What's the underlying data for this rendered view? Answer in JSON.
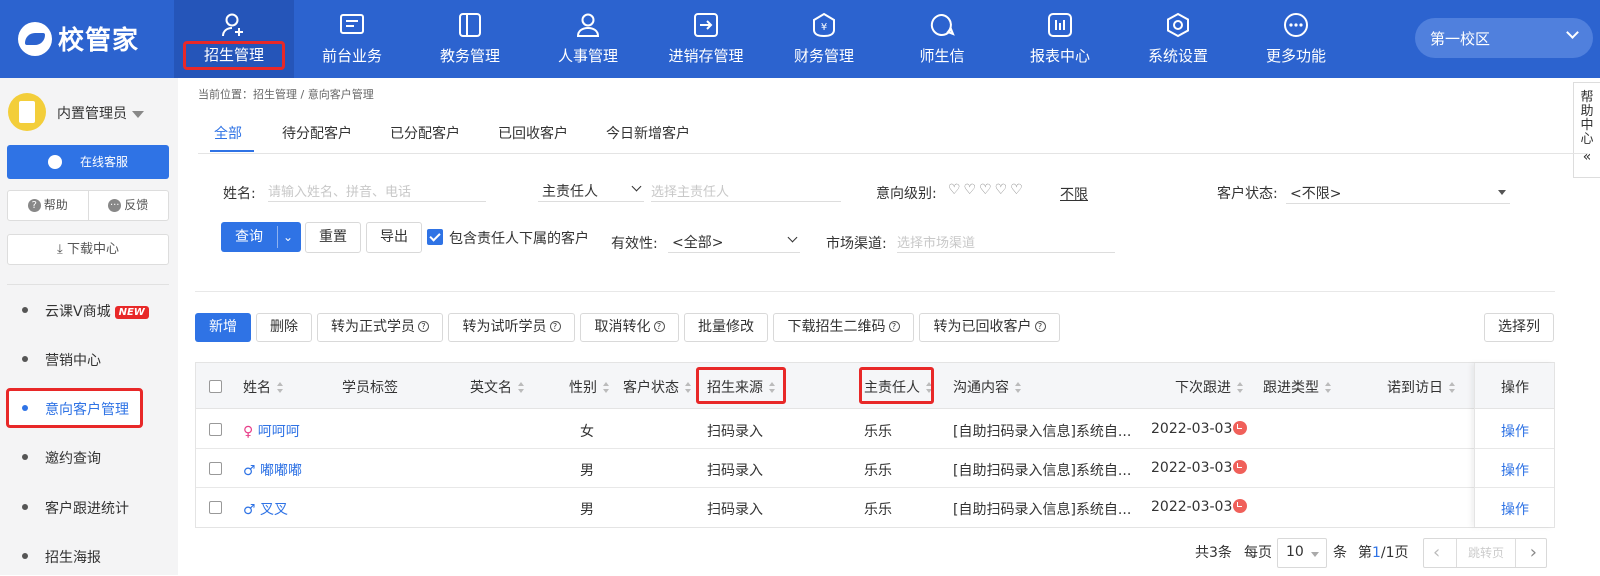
{
  "app": {
    "logo_text": "校管家",
    "campus": "第一校区"
  },
  "nav": [
    {
      "label": "招生管理",
      "icon": "user-add-icon"
    },
    {
      "label": "前台业务",
      "icon": "monitor-icon"
    },
    {
      "label": "教务管理",
      "icon": "book-icon"
    },
    {
      "label": "人事管理",
      "icon": "person-icon"
    },
    {
      "label": "进销存管理",
      "icon": "inventory-icon"
    },
    {
      "label": "财务管理",
      "icon": "finance-icon"
    },
    {
      "label": "师生信",
      "icon": "message-icon"
    },
    {
      "label": "报表中心",
      "icon": "report-icon"
    },
    {
      "label": "系统设置",
      "icon": "settings-icon"
    },
    {
      "label": "更多功能",
      "icon": "more-icon"
    }
  ],
  "sidebar": {
    "username": "内置管理员",
    "online_service": "在线客服",
    "help": "帮助",
    "feedback": "反馈",
    "download": "下载中心",
    "menu": [
      {
        "label": "云课V商城",
        "badge": "NEW"
      },
      {
        "label": "营销中心"
      },
      {
        "label": "意向客户管理"
      },
      {
        "label": "邀约查询"
      },
      {
        "label": "客户跟进统计"
      },
      {
        "label": "招生海报"
      }
    ]
  },
  "breadcrumb": "当前位置：招生管理 / 意向客户管理",
  "help_center": "帮助中心",
  "tabs": [
    "全部",
    "待分配客户",
    "已分配客户",
    "已回收客户",
    "今日新增客户"
  ],
  "filters": {
    "name_label": "姓名:",
    "name_placeholder": "请输入姓名、拼音、电话",
    "owner_select": "主责任人",
    "owner_placeholder": "选择主责任人",
    "level_label": "意向级别:",
    "level_hearts": "♡♡♡♡♡",
    "level_unlimited": "不限",
    "status_label": "客户状态:",
    "status_value": "<不限>",
    "validity_label": "有效性:",
    "validity_value": "<全部>",
    "channel_label": "市场渠道:",
    "channel_placeholder": "选择市场渠道",
    "include_sub": "包含责任人下属的客户"
  },
  "buttons": {
    "query": "查询",
    "reset": "重置",
    "export": "导出",
    "add": "新增",
    "delete": "删除",
    "to_formal": "转为正式学员",
    "to_trial": "转为试听学员",
    "cancel_convert": "取消转化",
    "batch_edit": "批量修改",
    "download_qr": "下载招生二维码",
    "to_recycled": "转为已回收客户",
    "select_columns": "选择列"
  },
  "table": {
    "headers": [
      "姓名",
      "学员标签",
      "英文名",
      "性别",
      "客户状态",
      "招生来源",
      "主责任人",
      "沟通内容",
      "下次跟进",
      "跟进类型",
      "诺到访日",
      "操作"
    ],
    "rows": [
      {
        "gender_icon": "♀",
        "name": "呵呵呵",
        "gender": "女",
        "source": "扫码录入",
        "owner": "乐乐",
        "content": "[自助扫码录入信息]系统自...",
        "next": "2022-03-03",
        "op": "操作"
      },
      {
        "gender_icon": "♂",
        "name": "嘟嘟嘟",
        "gender": "男",
        "source": "扫码录入",
        "owner": "乐乐",
        "content": "[自助扫码录入信息]系统自...",
        "next": "2022-03-03",
        "op": "操作"
      },
      {
        "gender_icon": "♂",
        "name": "叉叉",
        "gender": "男",
        "source": "扫码录入",
        "owner": "乐乐",
        "content": "[自助扫码录入信息]系统自...",
        "next": "2022-03-03",
        "op": "操作"
      }
    ]
  },
  "pagination": {
    "total": "共3条",
    "per_page_label": "每页",
    "per_page": "10",
    "unit": "条",
    "page_prefix": "第",
    "current_page": "1",
    "page_suffix": "/1页",
    "jump": "跳转页"
  },
  "colors": {
    "primary": "#2c63cf",
    "accent": "#2f73e5",
    "highlight": "#e82828"
  }
}
